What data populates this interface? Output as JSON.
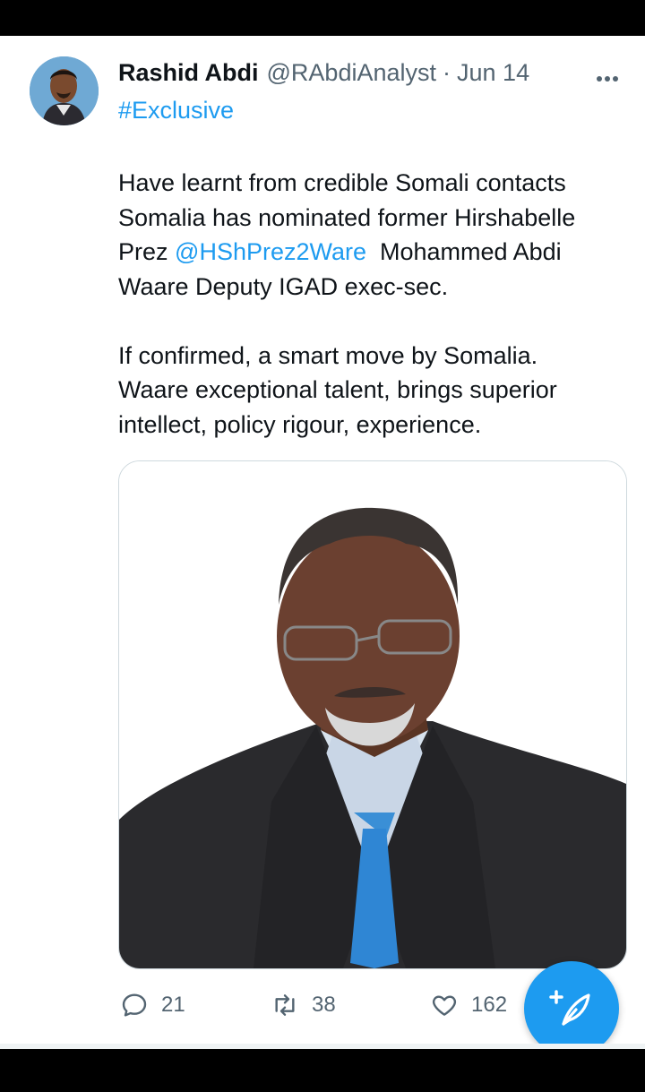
{
  "tweet": {
    "author_name": "Rashid Abdi",
    "handle": "@RAbdiAnalyst",
    "separator": "·",
    "date": "Jun 14",
    "hashtag": "#Exclusive",
    "para1_line1": "Have learnt from credible Somali contacts",
    "para1_line2": "Somalia has nominated former Hirshabelle",
    "para1_line3_prefix": "Prez ",
    "mention": "@HShPrez2Ware",
    "para1_line3_suffix": "  Mohammed Abdi",
    "para1_line4": "Waare Deputy IGAD exec-sec.",
    "para2_line1": "If confirmed, a smart move by Somalia.",
    "para2_line2": "Waare exceptional talent, brings superior",
    "para2_line3": "intellect, policy rigour, experience."
  },
  "stats": {
    "replies": "21",
    "retweets": "38",
    "likes": "162"
  },
  "icons": {
    "more": "more-horizontal-icon",
    "reply": "reply-icon",
    "retweet": "retweet-icon",
    "like": "heart-icon",
    "compose": "compose-tweet-icon"
  },
  "colors": {
    "accent": "#1d9bf0",
    "secondary_text": "#536471",
    "primary_text": "#0f1419"
  }
}
